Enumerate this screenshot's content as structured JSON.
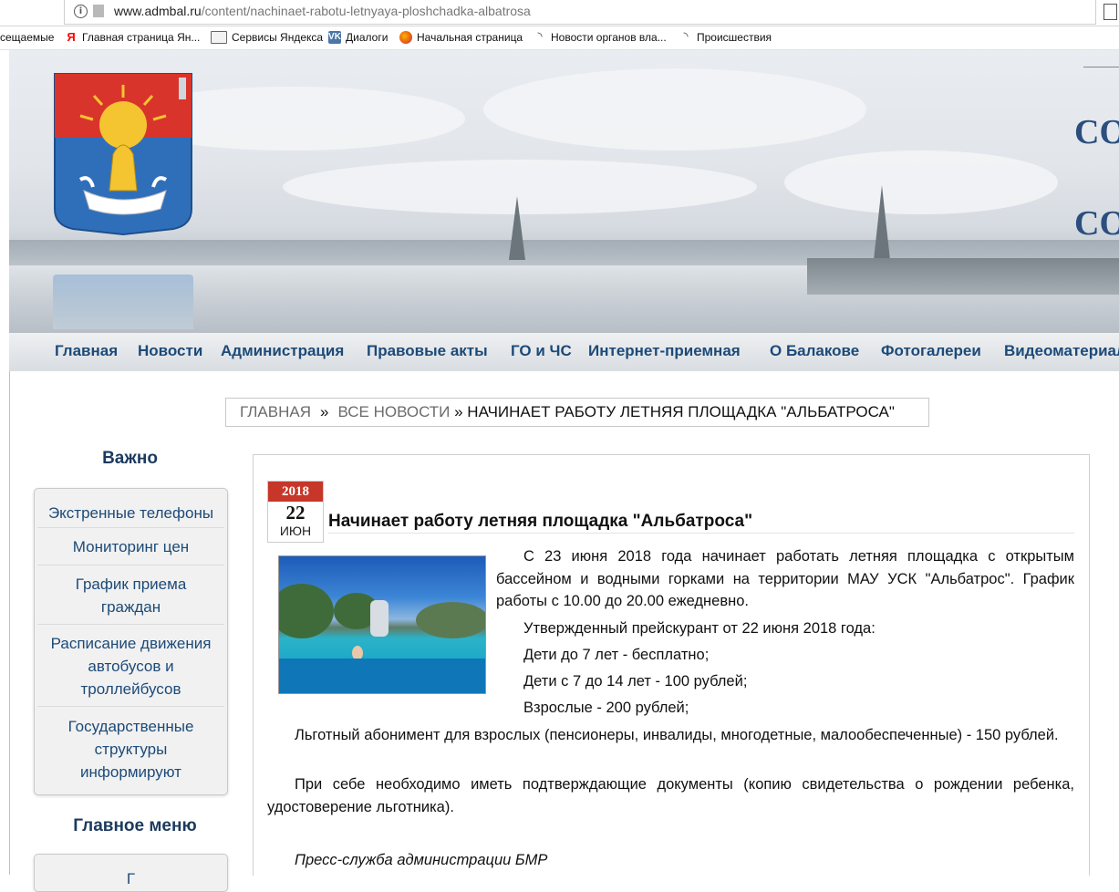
{
  "browser": {
    "url_host": "www.admbal.ru",
    "url_path": "/content/nachinaet-rabotu-letnyaya-ploshchadka-albatrosa",
    "bookmarks": [
      {
        "label": "сещаемые",
        "icon": "none"
      },
      {
        "label": "Главная страница Ян...",
        "icon": "yandex-icon"
      },
      {
        "label": "Сервисы Яндекса",
        "icon": "folder-icon"
      },
      {
        "label": "Диалоги",
        "icon": "vk-icon"
      },
      {
        "label": "Начальная страница",
        "icon": "firefox-icon"
      },
      {
        "label": "Новости органов вла...",
        "icon": "rss-icon"
      },
      {
        "label": "Происшествия",
        "icon": "rss-icon"
      }
    ]
  },
  "header": {
    "banner_text_1": "СО",
    "banner_text_2": "СО",
    "menu": [
      "Главная",
      "Новости",
      "Администрация",
      "Правовые акты",
      "ГО и ЧС",
      "Интернет-приемная",
      "О Балакове",
      "Фотогалереи",
      "Видеоматериал"
    ]
  },
  "breadcrumb": {
    "home": "ГЛАВНАЯ",
    "sep": "»",
    "news": "ВСЕ НОВОСТИ",
    "current": "» НАЧИНАЕТ РАБОТУ ЛЕТНЯЯ ПЛОЩАДКА \"АЛЬБАТРОСА\""
  },
  "sidebar": {
    "important_title": "Важно",
    "important_links": [
      "Экстренные телефоны",
      "Мониторинг цен",
      "График приема граждан",
      "Расписание движения автобусов и троллейбусов",
      "Государственные структуры информируют"
    ],
    "main_menu_title": "Главное меню",
    "main_menu_first": "Г"
  },
  "article": {
    "date_year": "2018",
    "date_day": "22",
    "date_month": "ИЮН",
    "title": "Начинает работу летняя площадка \"Альбатроса\"",
    "p1": "С 23 июня 2018 года  начинает работать летняя площадка с открытым бассейном и водными горками на территории МАУ УСК \"Альбатрос\". График работы с 10.00 до 20.00 ежедневно.",
    "p2": "Утвержденный прейскурант от 22 июня 2018 года:",
    "p3": "Дети до 7 лет - бесплатно;",
    "p4": "Дети с 7 до 14 лет - 100 рублей;",
    "p5": "Взрослые - 200 рублей;",
    "p6": "Льготный абонимент для взрослых (пенсионеры, инвалиды, многодетные, малообеспеченные) - 150 рублей.",
    "p7": "При себе необходимо иметь подтверждающие документы (копию свидетельства о рождении ребенка, удостоверение льготника).",
    "signature": "Пресс-служба администрации БМР"
  },
  "colors": {
    "menu_text": "#1c4a78",
    "date_red": "#c6372a",
    "banner_text": "#2b4e7e"
  }
}
